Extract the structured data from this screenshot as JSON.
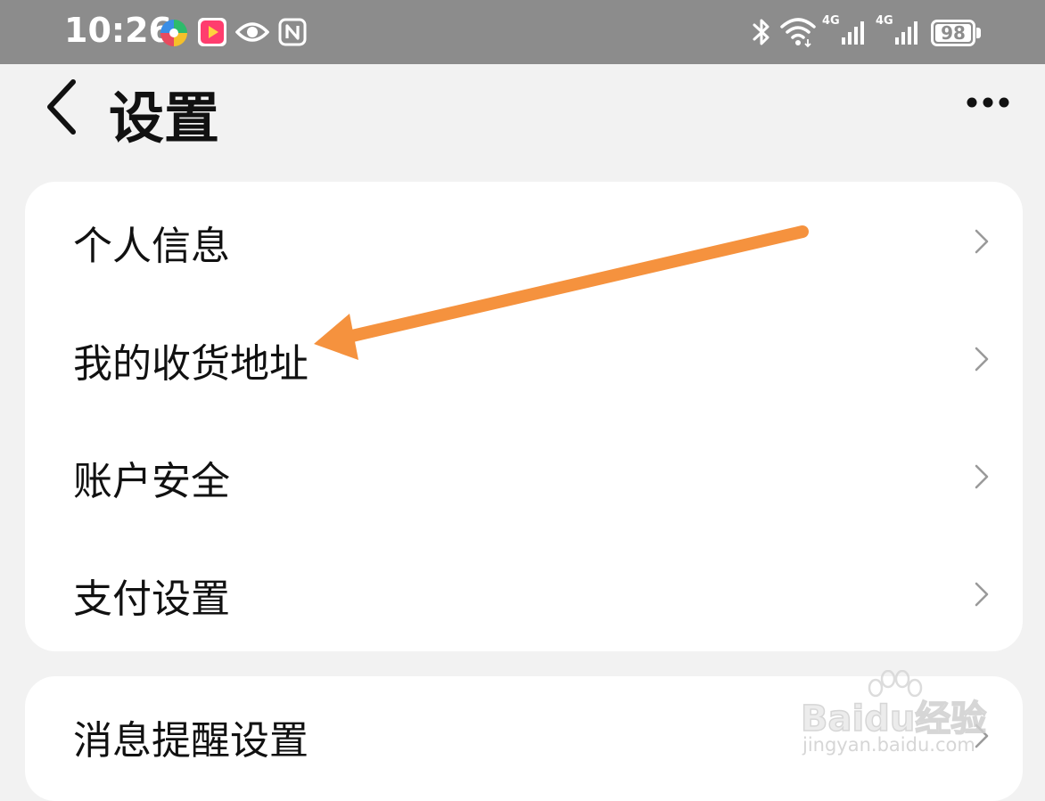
{
  "status_bar": {
    "time": "10:26",
    "battery": "98",
    "network_1": "4G",
    "network_2": "4G",
    "icons": [
      "colorful-app-icon",
      "video-app-icon",
      "eye-icon",
      "nfc-icon",
      "bluetooth-icon",
      "wifi-icon",
      "signal-icon",
      "signal-icon",
      "battery-icon"
    ]
  },
  "header": {
    "title": "设置",
    "back_icon": "chevron-left-icon",
    "more_icon": "more-dots-icon"
  },
  "sections": [
    {
      "items": [
        {
          "label": "个人信息"
        },
        {
          "label": "我的收货地址"
        },
        {
          "label": "账户安全"
        },
        {
          "label": "支付设置"
        }
      ]
    },
    {
      "items": [
        {
          "label": "消息提醒设置"
        }
      ]
    }
  ],
  "annotation": {
    "type": "arrow",
    "color": "#f5923e",
    "target": "我的收货地址"
  },
  "watermark": {
    "brand": "Baidu经验",
    "url": "jingyan.baidu.com"
  },
  "colors": {
    "status_bar_bg": "#8c8c8c",
    "page_bg": "#f2f2f2",
    "card_bg": "#ffffff",
    "text": "#111111",
    "chevron": "#9a9a9a"
  }
}
